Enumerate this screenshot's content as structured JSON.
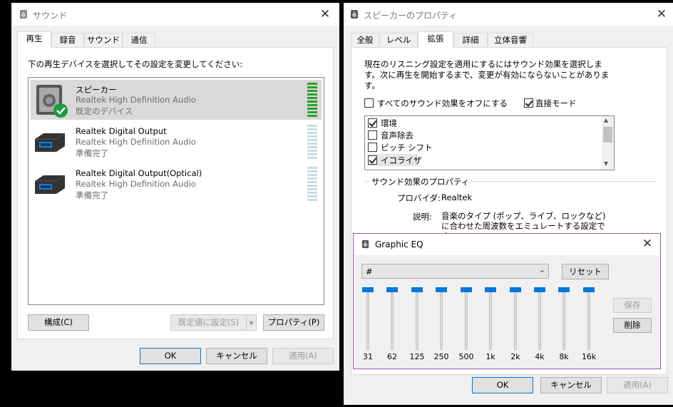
{
  "sound_dialog": {
    "title": "サウンド",
    "tabs": [
      "再生",
      "録音",
      "サウンド",
      "通信"
    ],
    "instruction": "下の再生デバイスを選択してその設定を変更してください:",
    "devices": [
      {
        "name": "スピーカー",
        "driver": "Realtek High Definition Audio",
        "status": "既定のデバイス",
        "level": 10
      },
      {
        "name": "Realtek Digital Output",
        "driver": "Realtek High Definition Audio",
        "status": "準備完了",
        "level": 0
      },
      {
        "name": "Realtek Digital Output(Optical)",
        "driver": "Realtek High Definition Audio",
        "status": "準備完了",
        "level": 0
      }
    ],
    "configure_button": "構成(C)",
    "set_default_button": "既定値に設定(S)",
    "properties_button": "プロパティ(P)",
    "ok_button": "OK",
    "cancel_button": "キャンセル",
    "apply_button": "適用(A)"
  },
  "speaker_props": {
    "title": "スピーカーのプロパティ",
    "tabs": [
      "全般",
      "レベル",
      "拡張",
      "詳細",
      "立体音響"
    ],
    "description": "現在のリスニング設定を適用にするにはサウンド効果を選択します。次に再生を開始するまで、変更が有効にならないことがあります。",
    "disable_all_label": "すべてのサウンド効果をオフにする",
    "disable_all_checked": false,
    "immediate_mode_label": "直接モード",
    "immediate_mode_checked": true,
    "effects": [
      {
        "label": "環境",
        "checked": true
      },
      {
        "label": "音声除去",
        "checked": false
      },
      {
        "label": "ピッチ シフト",
        "checked": false
      },
      {
        "label": "イコライザ",
        "checked": true
      }
    ],
    "effect_props_group": "サウンド効果のプロパティ",
    "provider_label": "プロバイダ:",
    "provider_value": "Realtek",
    "desc_label": "説明:",
    "desc_value": "音楽のタイプ (ポップ、ライブ、ロックなど) に合わせた周波数をエミュレートする設定です",
    "ok_button": "OK",
    "cancel_button": "キャンセル",
    "apply_button": "適用(A)"
  },
  "graphic_eq": {
    "title": "Graphic EQ",
    "preset_value": "#",
    "reset_button": "リセット",
    "save_button": "保存",
    "delete_button": "削除",
    "bands": [
      {
        "label": "31",
        "level": 1.0
      },
      {
        "label": "62",
        "level": 1.0
      },
      {
        "label": "125",
        "level": 1.0
      },
      {
        "label": "250",
        "level": 1.0
      },
      {
        "label": "500",
        "level": 1.0
      },
      {
        "label": "1k",
        "level": 1.0
      },
      {
        "label": "2k",
        "level": 1.0
      },
      {
        "label": "4k",
        "level": 1.0
      },
      {
        "label": "8k",
        "level": 1.0
      },
      {
        "label": "16k",
        "level": 1.0
      }
    ]
  },
  "colors": {
    "accent": "#0078d7",
    "selection": "#d9d9d9",
    "level_on": "#2ca02c",
    "level_off": "#c8dde6",
    "eq_border": "#9b59b6"
  }
}
